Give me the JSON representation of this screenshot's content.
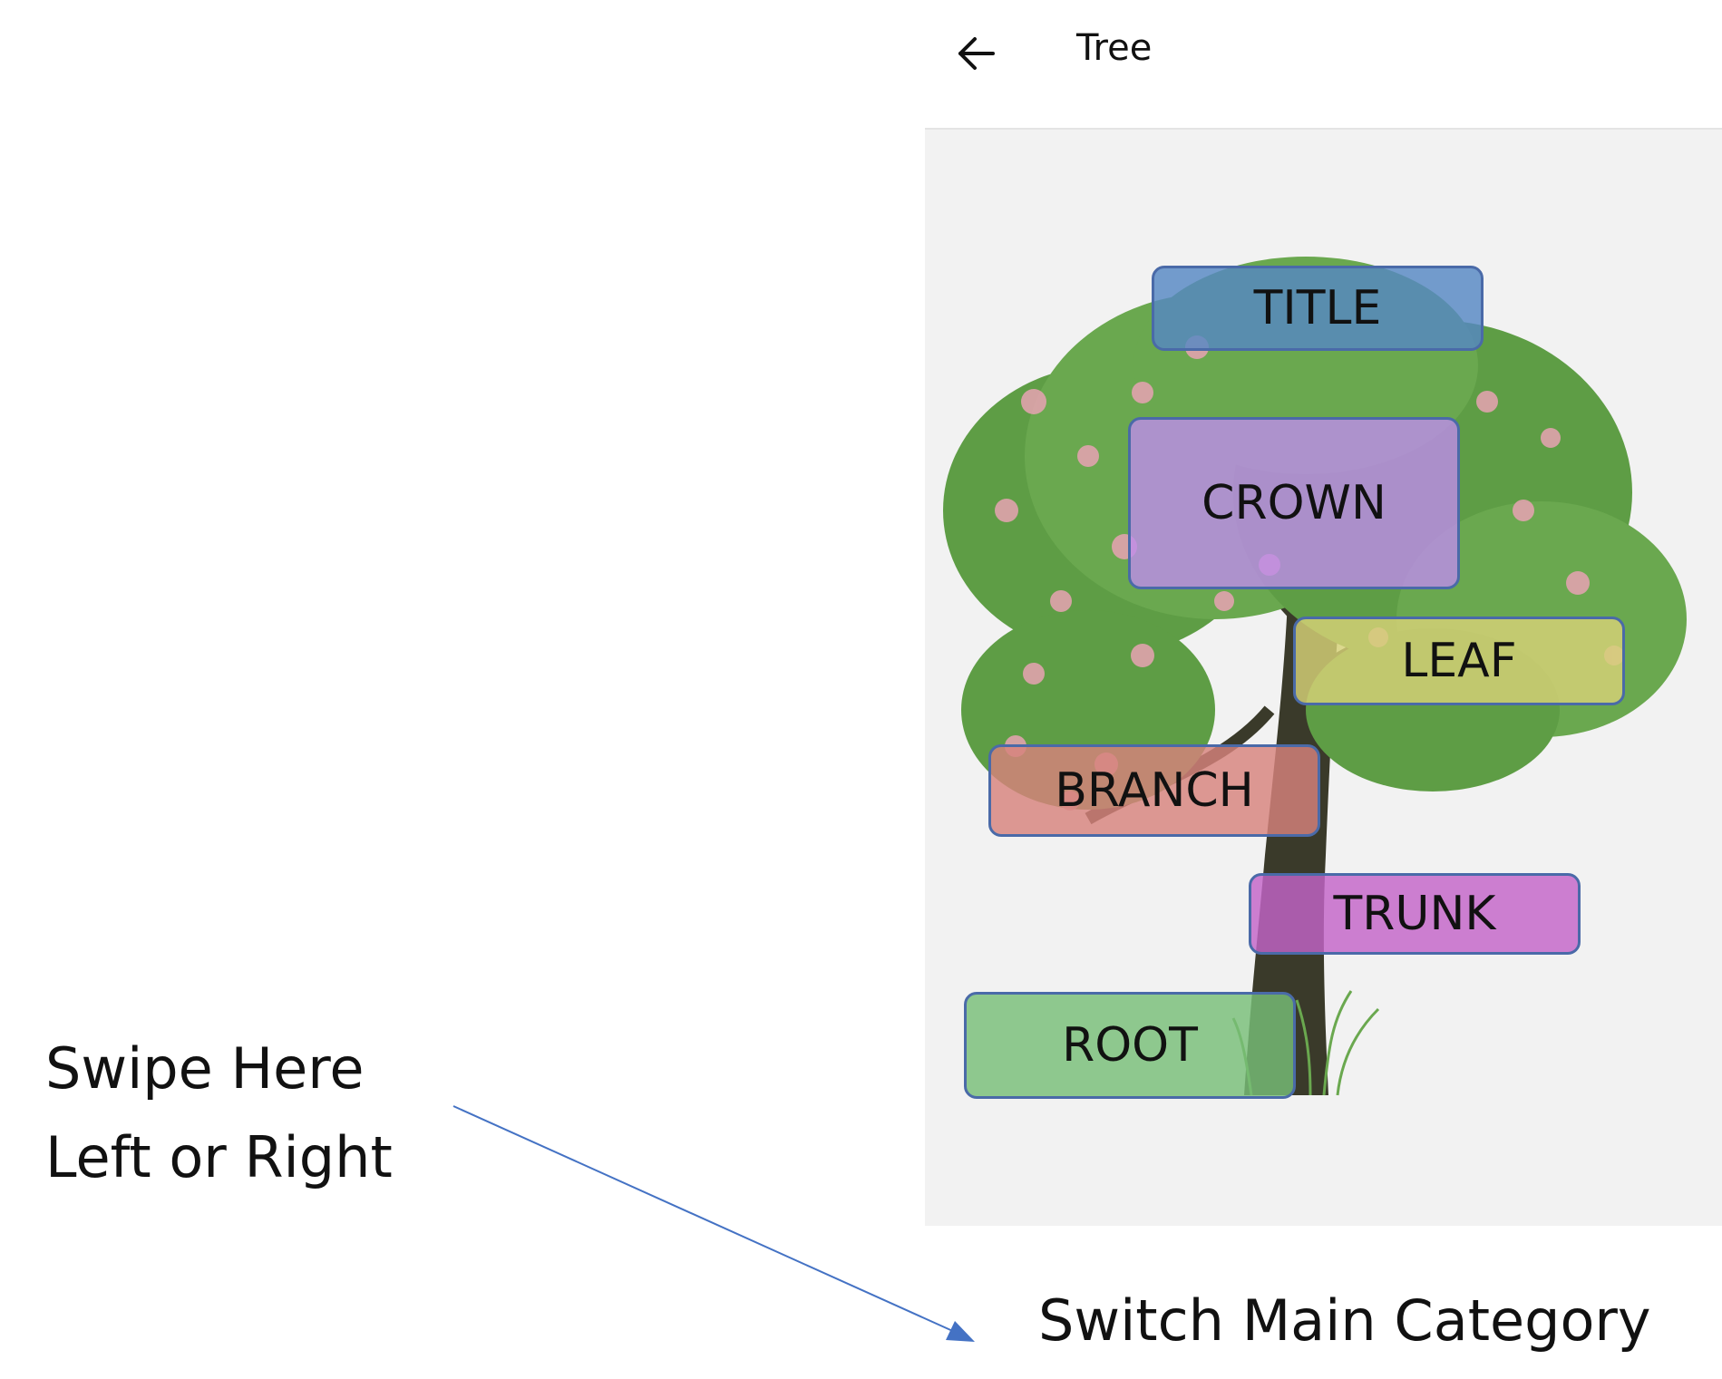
{
  "annotation": {
    "line1": "Swipe Here",
    "line2": "Left or Right"
  },
  "header": {
    "title": "Tree",
    "back_icon": "arrow-left-icon"
  },
  "labels": {
    "title": "TITLE",
    "crown": "CROWN",
    "leaf": "LEAF",
    "branch": "BRANCH",
    "trunk": "TRUNK",
    "root": "ROOT"
  },
  "footer": {
    "category_label": "Switch Main Category"
  },
  "colors": {
    "title": "#5587c3",
    "crown": "#be8ceb",
    "leaf": "#d7d278",
    "branch": "#d7827d",
    "trunk": "#c364c8",
    "root": "#78be78",
    "arrow": "#4472c4"
  }
}
